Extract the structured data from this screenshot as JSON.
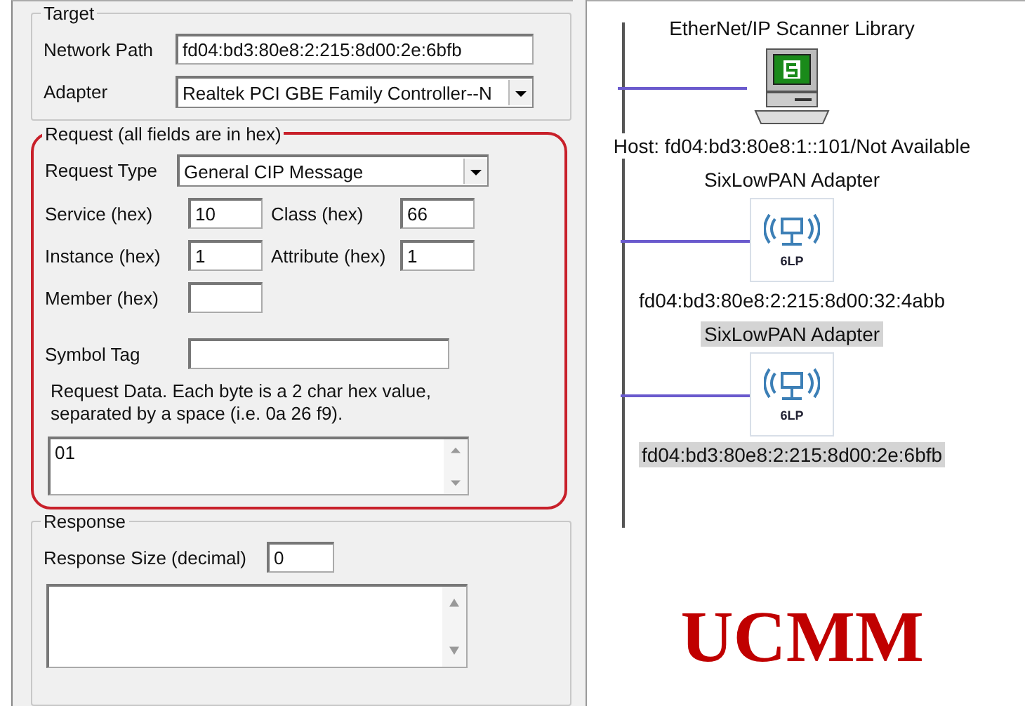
{
  "target": {
    "legend": "Target",
    "network_path": {
      "label": "Network Path",
      "value": "fd04:bd3:80e8:2:215:8d00:2e:6bfb"
    },
    "adapter": {
      "label": "Adapter",
      "value": "Realtek PCI GBE Family Controller--N"
    }
  },
  "request": {
    "legend": "Request (all fields are in hex)",
    "highlighted": true,
    "request_type": {
      "label": "Request Type",
      "value": "General CIP Message"
    },
    "rows": [
      [
        {
          "label": "Service (hex)",
          "value": "10"
        },
        {
          "label": "Class (hex)",
          "value": "66"
        }
      ],
      [
        {
          "label": "Instance (hex)",
          "value": "1"
        },
        {
          "label": "Attribute (hex)",
          "value": "1"
        }
      ],
      [
        {
          "label": "Member (hex)"
        }
      ]
    ],
    "symbol_tag": {
      "label": "Symbol Tag"
    },
    "note": "Request Data. Each byte is a 2 char hex value, separated by a space (i.e. 0a 26 f9).",
    "data": "01"
  },
  "response": {
    "legend": "Response",
    "size": {
      "label": "Response Size (decimal)",
      "value": "0"
    }
  },
  "tree": {
    "nodes": [
      {
        "kind": "host",
        "title": "EtherNet/IP Scanner Library",
        "address": "Host: fd04:bd3:80e8:1::101/Not Available",
        "selected": false
      },
      {
        "kind": "adapter",
        "title": "SixLowPAN Adapter",
        "badge": "6LP",
        "address": "fd04:bd3:80e8:2:215:8d00:32:4abb",
        "selected": false
      },
      {
        "kind": "adapter",
        "title": "SixLowPAN Adapter",
        "badge": "6LP",
        "address": "fd04:bd3:80e8:2:215:8d00:2e:6bfb",
        "selected": true
      }
    ]
  },
  "annotation": "UCMM"
}
